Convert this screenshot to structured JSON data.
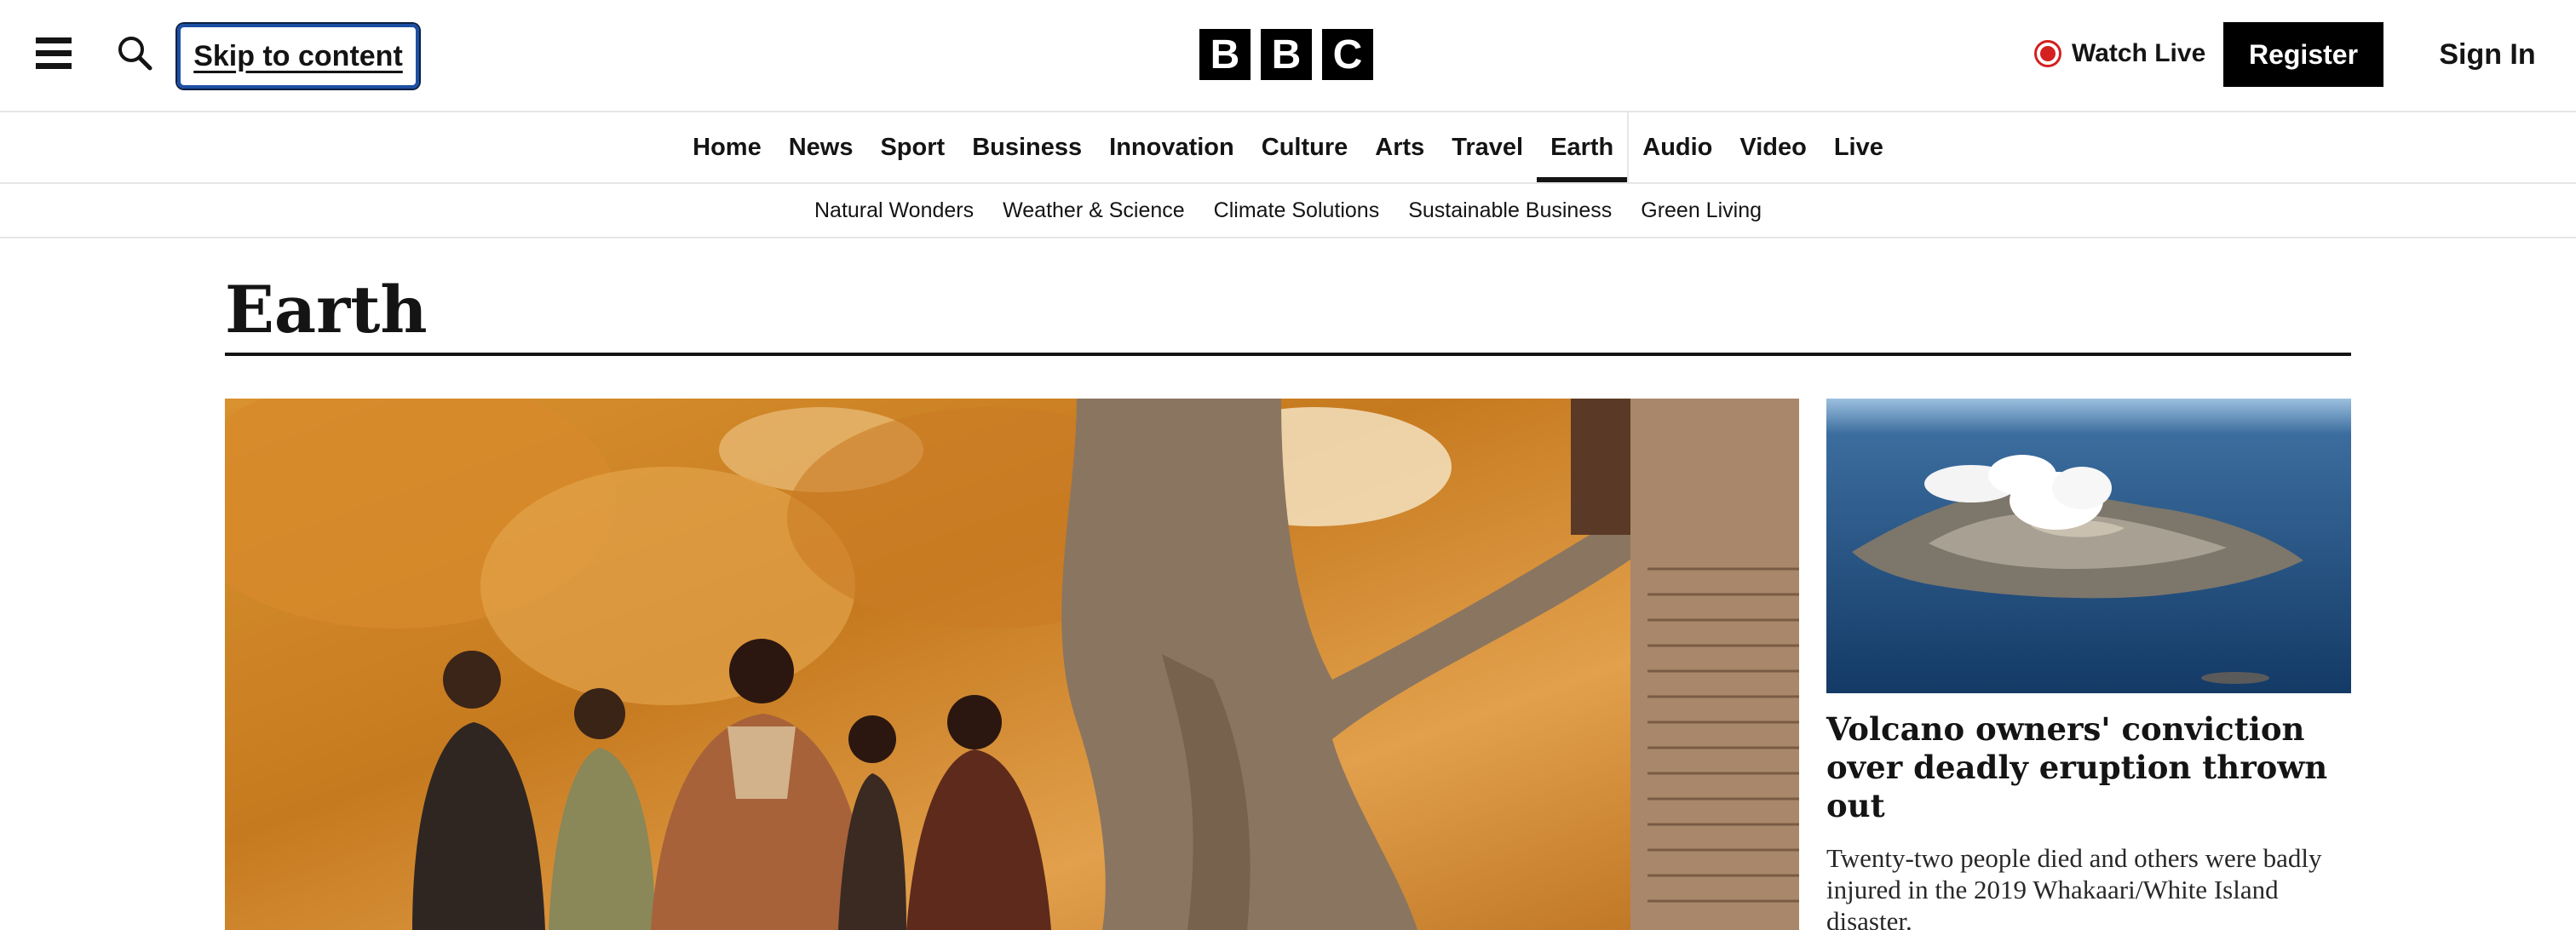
{
  "header": {
    "menu_icon": "hamburger-menu-icon",
    "search_icon": "search-icon",
    "skip_link": "Skip to content",
    "logo_letters": [
      "B",
      "B",
      "C"
    ],
    "watch_live": "Watch Live",
    "register": "Register",
    "sign_in": "Sign In",
    "live_color": "#d4201f"
  },
  "primary_nav": {
    "items": [
      "Home",
      "News",
      "Sport",
      "Business",
      "Innovation",
      "Culture",
      "Arts",
      "Travel",
      "Earth",
      "Audio",
      "Video",
      "Live"
    ],
    "active": "Earth"
  },
  "sub_nav": {
    "items": [
      "Natural Wonders",
      "Weather & Science",
      "Climate Solutions",
      "Sustainable Business",
      "Green Living"
    ]
  },
  "page": {
    "title": "Earth"
  },
  "hero": {
    "image": "hero-photo-autumn-trees-group-of-women"
  },
  "side_story": {
    "image": "aerial-photo-volcanic-island",
    "headline": "Volcano owners' conviction over deadly eruption thrown out",
    "summary": "Twenty-two people died and others were badly injured in the 2019 Whakaari/White Island disaster."
  }
}
